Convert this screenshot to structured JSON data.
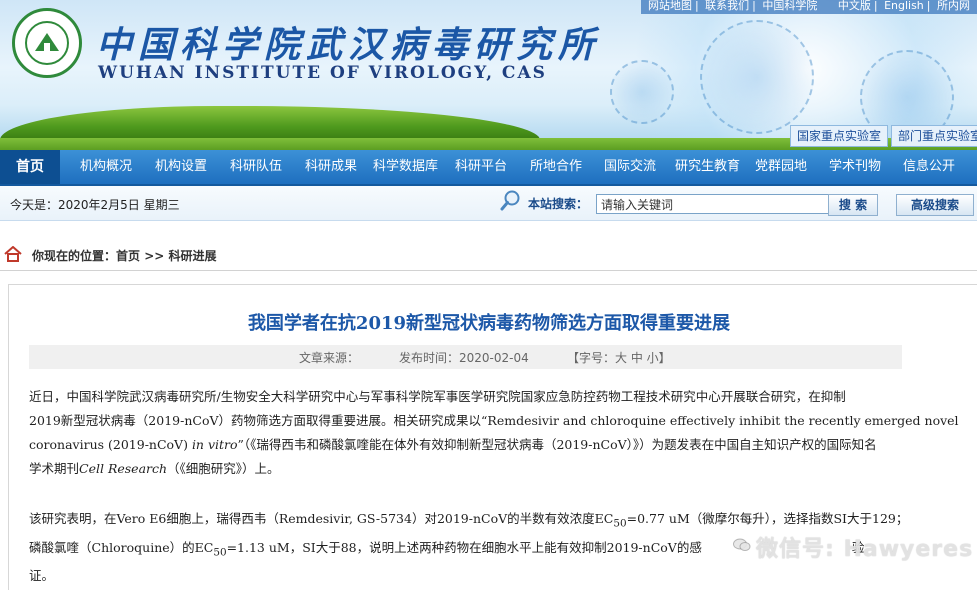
{
  "header": {
    "title_cn": "中国科学院武汉病毒研究所",
    "title_en": "WUHAN INSTITUTE OF VIROLOGY, CAS",
    "top_links": [
      "网站地图",
      "联系我们",
      "中国科学院",
      "中文版",
      "English",
      "所内网"
    ],
    "labs": [
      "国家重点实验室",
      "部门重点实验室"
    ]
  },
  "nav": {
    "items": [
      "首页",
      "机构概况",
      "机构设置",
      "科研队伍",
      "科研成果",
      "科学数据库",
      "科研平台",
      "所地合作",
      "国际交流",
      "研究生教育",
      "党群园地",
      "学术刊物",
      "信息公开"
    ]
  },
  "infobar": {
    "date": "今天是：2020年2月5日  星期三",
    "search_label": "本站搜索：",
    "search_placeholder": "请输入关键词",
    "search_button": "搜 索",
    "advanced_button": "高级搜索"
  },
  "breadcrumb": {
    "prefix": "你现在的位置：",
    "home": "首页",
    "sep": " >> ",
    "current": "科研进展"
  },
  "article": {
    "title": "我国学者在抗2019新型冠状病毒药物筛选方面取得重要进展",
    "source": "文章来源：",
    "published": "发布时间：2020-02-04",
    "fontsize": "【字号：大  中  小】",
    "p1_line1": "近日，中国科学院武汉病毒研究所/生物安全大科学研究中心与军事科学院军事医学研究院国家应急防控药物工程技术研究中心开展联合研究，在抑制",
    "p1_line2": "2019新型冠状病毒（2019-nCoV）药物筛选方面取得重要进展。相关研究成果以“Remdesivir and chloroquine effectively inhibit the recently emerged novel",
    "p1_line3_a": "coronavirus (2019-nCoV) ",
    "p1_line3_b": "in vitro",
    "p1_line3_c": "”（《瑞得西韦和磷酸氯喹能在体外有效抑制新型冠状病毒（2019-nCoV）》）为题发表在中国自主知识产权的国际知名",
    "p1_line4_a": "学术期刊",
    "p1_line4_b": "Cell Research",
    "p1_line4_c": "（《细胞研究》）上。",
    "p2_line1_a": "该研究表明，在Vero E6细胞上，瑞得西韦（Remdesivir, GS-5734）对2019-nCoV的半数有效浓度EC",
    "p2_sub": "50",
    "p2_line1_b": "=0.77 uM（微摩尔每升），选择指数SI大于129；",
    "p2_line2_a": "磷酸氯喹（Chloroquine）的EC",
    "p2_line2_b": "=1.13 uM，SI大于88，说明上述两种药物在细胞水平上能有效抑制2019-nCoV的感",
    "p2_line2_c": "验",
    "p2_line3": "证。"
  },
  "watermark": "微信号: Hawyeres"
}
